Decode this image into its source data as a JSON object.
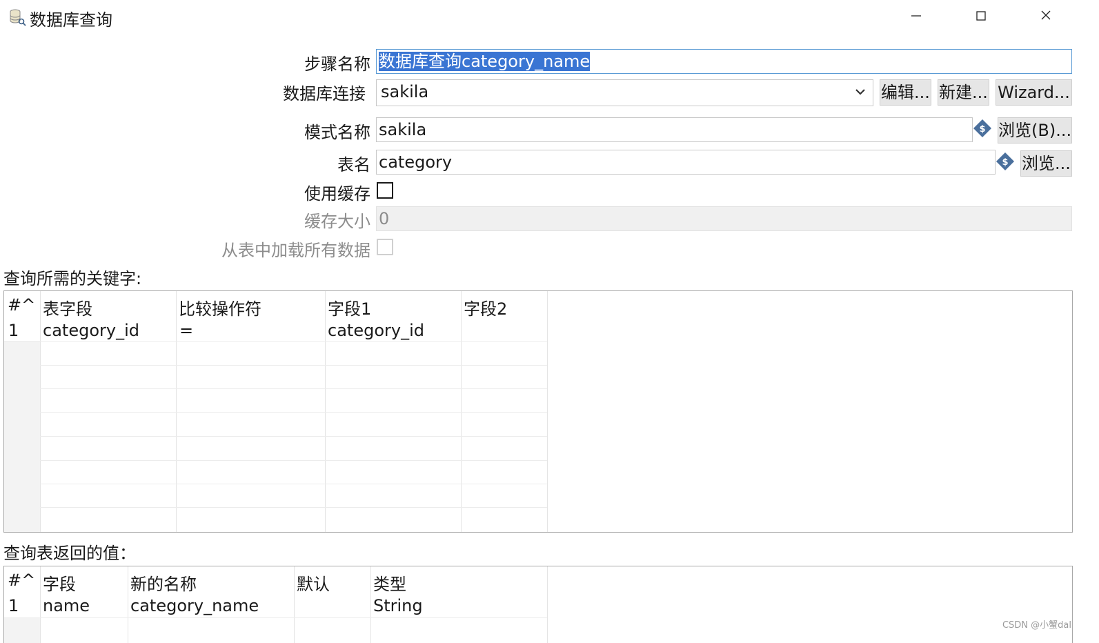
{
  "window": {
    "title": "数据库查询",
    "icons": {
      "app": "database-search-icon",
      "minimize": "minimize-icon",
      "maximize": "maximize-icon",
      "close": "close-icon"
    }
  },
  "form": {
    "step_name": {
      "label": "步骤名称",
      "value": "数据库查询category_name"
    },
    "db_connection": {
      "label": "数据库连接",
      "value": "sakila",
      "edit_button": "编辑...",
      "new_button": "新建...",
      "wizard_button": "Wizard..."
    },
    "schema_name": {
      "label": "模式名称",
      "value": "sakila",
      "browse_button": "浏览(B)..."
    },
    "table_name": {
      "label": "表名",
      "value": "category",
      "browse_button": "浏览..."
    },
    "use_cache": {
      "label": "使用缓存",
      "checked": false
    },
    "cache_size": {
      "label": "缓存大小",
      "value": "0"
    },
    "load_all": {
      "label": "从表中加载所有数据",
      "checked": false
    }
  },
  "keys_section": {
    "label": "查询所需的关键字:",
    "columns": [
      "#^",
      "表字段",
      "比较操作符",
      "字段1",
      "字段2"
    ],
    "rows": [
      {
        "num": "1",
        "table_field": "category_id",
        "comparator": "=",
        "field1": "category_id",
        "field2": ""
      }
    ]
  },
  "returns_section": {
    "label": "查询表返回的值：",
    "columns": [
      "#^",
      "字段",
      "新的名称",
      "默认",
      "类型"
    ],
    "rows": [
      {
        "num": "1",
        "field": "name",
        "new_name": "category_name",
        "default": "",
        "type": "String"
      }
    ]
  },
  "watermark": "CSDN @小蟹dal",
  "colors": {
    "selection": "#3a75d3",
    "focus_border": "#5b9bd5",
    "button_bg": "#e6e6e6",
    "variable_icon": "#4a6f9c"
  }
}
